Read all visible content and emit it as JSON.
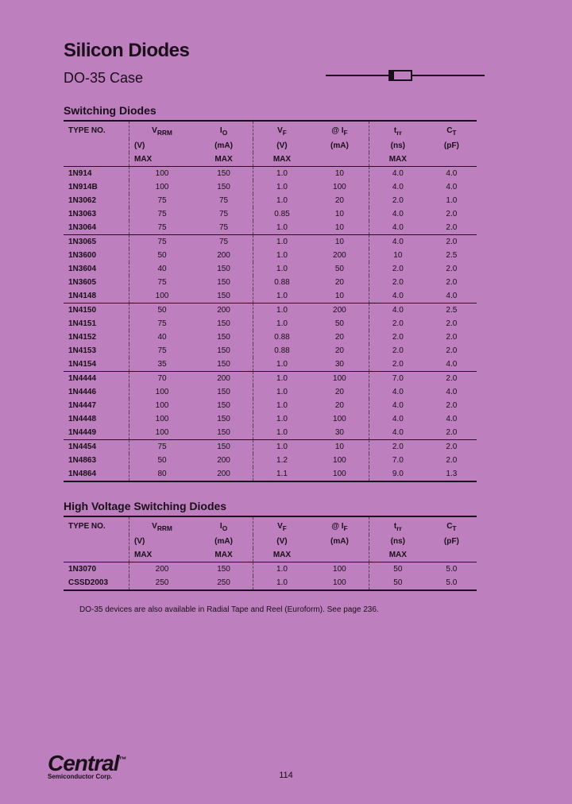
{
  "title": "Silicon Diodes",
  "subtitle": "DO-35 Case",
  "section1_title": "Switching Diodes",
  "section2_title": "High Voltage Switching Diodes",
  "footnote": "DO-35 devices are also available in Radial Tape and Reel (Euroform). See page 236.",
  "logo": "Central",
  "logo_sub": "Semiconductor Corp.",
  "tm": "™",
  "page_num": "114",
  "headers": {
    "type": "TYPE NO.",
    "vrrm_1": "V",
    "vrrm_sub": "RRM",
    "io_1": "I",
    "io_sub": "O",
    "vf_1": "V",
    "vf_sub": "F",
    "if_1": "@ I",
    "if_sub": "F",
    "trr_1": "t",
    "trr_sub": "rr",
    "ct_1": "C",
    "ct_sub": "T",
    "unit_v": "(V)",
    "unit_ma": "(mA)",
    "unit_ns": "(ns)",
    "unit_pf": "(pF)",
    "max": "MAX"
  },
  "table1_groups": [
    [
      [
        "1N914",
        "100",
        "150",
        "1.0",
        "10",
        "4.0",
        "4.0"
      ],
      [
        "1N914B",
        "100",
        "150",
        "1.0",
        "100",
        "4.0",
        "4.0"
      ],
      [
        "1N3062",
        "75",
        "75",
        "1.0",
        "20",
        "2.0",
        "1.0"
      ],
      [
        "1N3063",
        "75",
        "75",
        "0.85",
        "10",
        "4.0",
        "2.0"
      ],
      [
        "1N3064",
        "75",
        "75",
        "1.0",
        "10",
        "4.0",
        "2.0"
      ]
    ],
    [
      [
        "1N3065",
        "75",
        "75",
        "1.0",
        "10",
        "4.0",
        "2.0"
      ],
      [
        "1N3600",
        "50",
        "200",
        "1.0",
        "200",
        "10",
        "2.5"
      ],
      [
        "1N3604",
        "40",
        "150",
        "1.0",
        "50",
        "2.0",
        "2.0"
      ],
      [
        "1N3605",
        "75",
        "150",
        "0.88",
        "20",
        "2.0",
        "2.0"
      ],
      [
        "1N4148",
        "100",
        "150",
        "1.0",
        "10",
        "4.0",
        "4.0"
      ]
    ],
    [
      [
        "1N4150",
        "50",
        "200",
        "1.0",
        "200",
        "4.0",
        "2.5"
      ],
      [
        "1N4151",
        "75",
        "150",
        "1.0",
        "50",
        "2.0",
        "2.0"
      ],
      [
        "1N4152",
        "40",
        "150",
        "0.88",
        "20",
        "2.0",
        "2.0"
      ],
      [
        "1N4153",
        "75",
        "150",
        "0.88",
        "20",
        "2.0",
        "2.0"
      ],
      [
        "1N4154",
        "35",
        "150",
        "1.0",
        "30",
        "2.0",
        "4.0"
      ]
    ],
    [
      [
        "1N4444",
        "70",
        "200",
        "1.0",
        "100",
        "7.0",
        "2.0"
      ],
      [
        "1N4446",
        "100",
        "150",
        "1.0",
        "20",
        "4.0",
        "4.0"
      ],
      [
        "1N4447",
        "100",
        "150",
        "1.0",
        "20",
        "4.0",
        "2.0"
      ],
      [
        "1N4448",
        "100",
        "150",
        "1.0",
        "100",
        "4.0",
        "4.0"
      ],
      [
        "1N4449",
        "100",
        "150",
        "1.0",
        "30",
        "4.0",
        "2.0"
      ]
    ],
    [
      [
        "1N4454",
        "75",
        "150",
        "1.0",
        "10",
        "2.0",
        "2.0"
      ],
      [
        "1N4863",
        "50",
        "200",
        "1.2",
        "100",
        "7.0",
        "2.0"
      ],
      [
        "1N4864",
        "80",
        "200",
        "1.1",
        "100",
        "9.0",
        "1.3"
      ]
    ]
  ],
  "table2_rows": [
    [
      "1N3070",
      "200",
      "150",
      "1.0",
      "100",
      "50",
      "5.0"
    ],
    [
      "CSSD2003",
      "250",
      "250",
      "1.0",
      "100",
      "50",
      "5.0"
    ]
  ]
}
